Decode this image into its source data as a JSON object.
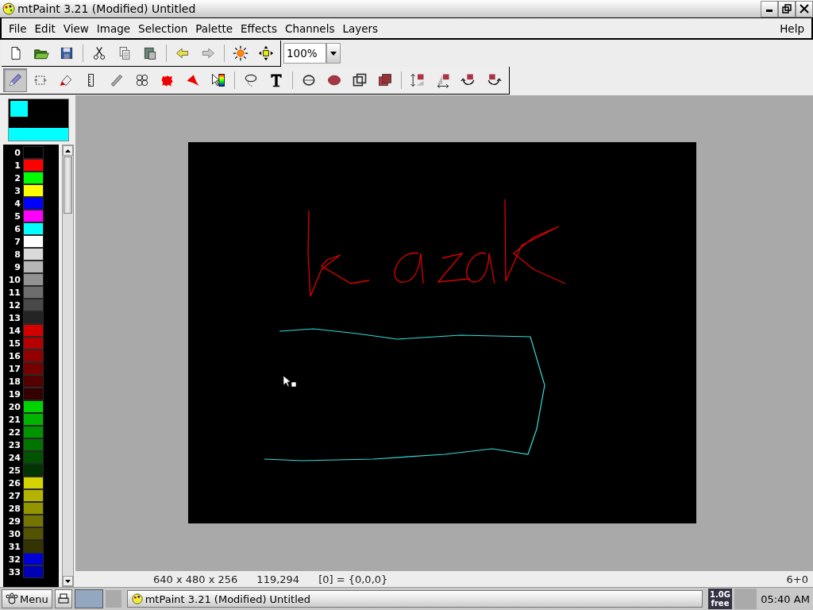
{
  "window": {
    "title": "mtPaint 3.21 (Modified) Untitled"
  },
  "menu": [
    "File",
    "Edit",
    "View",
    "Image",
    "Selection",
    "Palette",
    "Effects",
    "Channels",
    "Layers"
  ],
  "help_menu": "Help",
  "toolbar": [
    {
      "kind": "new"
    },
    {
      "kind": "open"
    },
    {
      "kind": "save"
    },
    {
      "kind": "separator"
    },
    {
      "kind": "cut"
    },
    {
      "kind": "copy"
    },
    {
      "kind": "paste"
    },
    {
      "kind": "separator"
    },
    {
      "kind": "undo"
    },
    {
      "kind": "redo"
    },
    {
      "kind": "separator"
    },
    {
      "kind": "sun"
    },
    {
      "kind": "move"
    }
  ],
  "zoom": {
    "value": "100%"
  },
  "tools": [
    {
      "kind": "pencil",
      "selected": true
    },
    {
      "kind": "marquee",
      "selected": false
    },
    {
      "kind": "bucket",
      "selected": false
    },
    {
      "kind": "ruler",
      "selected": false
    },
    {
      "kind": "brush",
      "selected": false
    },
    {
      "kind": "stamp",
      "selected": false
    },
    {
      "kind": "blob",
      "selected": false
    },
    {
      "kind": "cone",
      "selected": false
    },
    {
      "kind": "cursor",
      "selected": false
    },
    {
      "kind": "separator"
    },
    {
      "kind": "lasso",
      "selected": false
    },
    {
      "kind": "text",
      "selected": false
    },
    {
      "kind": "separator"
    },
    {
      "kind": "ellipse",
      "selected": false
    },
    {
      "kind": "disc",
      "selected": false
    },
    {
      "kind": "frame",
      "selected": false
    },
    {
      "kind": "square",
      "selected": false
    },
    {
      "kind": "separator"
    },
    {
      "kind": "flipv",
      "selected": false
    },
    {
      "kind": "fliph",
      "selected": false
    },
    {
      "kind": "rotl",
      "selected": false
    },
    {
      "kind": "rotr",
      "selected": false
    }
  ],
  "palette": [
    {
      "index": "0",
      "color": "#000000"
    },
    {
      "index": "1",
      "color": "#ff0000"
    },
    {
      "index": "2",
      "color": "#00ff00"
    },
    {
      "index": "3",
      "color": "#ffff00"
    },
    {
      "index": "4",
      "color": "#0000ff"
    },
    {
      "index": "5",
      "color": "#ff00ff"
    },
    {
      "index": "6",
      "color": "#00ffff"
    },
    {
      "index": "7",
      "color": "#ffffff"
    },
    {
      "index": "8",
      "color": "#dadada"
    },
    {
      "index": "9",
      "color": "#b6b6b6"
    },
    {
      "index": "10",
      "color": "#929292"
    },
    {
      "index": "11",
      "color": "#6d6d6d"
    },
    {
      "index": "12",
      "color": "#494949"
    },
    {
      "index": "13",
      "color": "#242424"
    },
    {
      "index": "14",
      "color": "#d40000"
    },
    {
      "index": "15",
      "color": "#b40000"
    },
    {
      "index": "16",
      "color": "#940000"
    },
    {
      "index": "17",
      "color": "#740000"
    },
    {
      "index": "18",
      "color": "#540000"
    },
    {
      "index": "19",
      "color": "#340000"
    },
    {
      "index": "20",
      "color": "#00d400"
    },
    {
      "index": "21",
      "color": "#00b400"
    },
    {
      "index": "22",
      "color": "#009400"
    },
    {
      "index": "23",
      "color": "#007400"
    },
    {
      "index": "24",
      "color": "#005400"
    },
    {
      "index": "25",
      "color": "#003400"
    },
    {
      "index": "26",
      "color": "#d4d400"
    },
    {
      "index": "27",
      "color": "#b4b400"
    },
    {
      "index": "28",
      "color": "#949400"
    },
    {
      "index": "29",
      "color": "#747400"
    },
    {
      "index": "30",
      "color": "#545400"
    },
    {
      "index": "31",
      "color": "#343400"
    },
    {
      "index": "32",
      "color": "#0000d4"
    },
    {
      "index": "33",
      "color": "#0000b4"
    }
  ],
  "status_bar": {
    "geometry": "640 x 480 x 256",
    "cursor": "119,294",
    "pixel": "[0] = {0,0,0}",
    "layers": "6+0"
  },
  "taskbar": {
    "menu": "Menu",
    "task": "mtPaint 3.21 (Modified) Untitled",
    "memory": [
      "1.0G",
      "free"
    ],
    "clock": "05:40 AM"
  }
}
